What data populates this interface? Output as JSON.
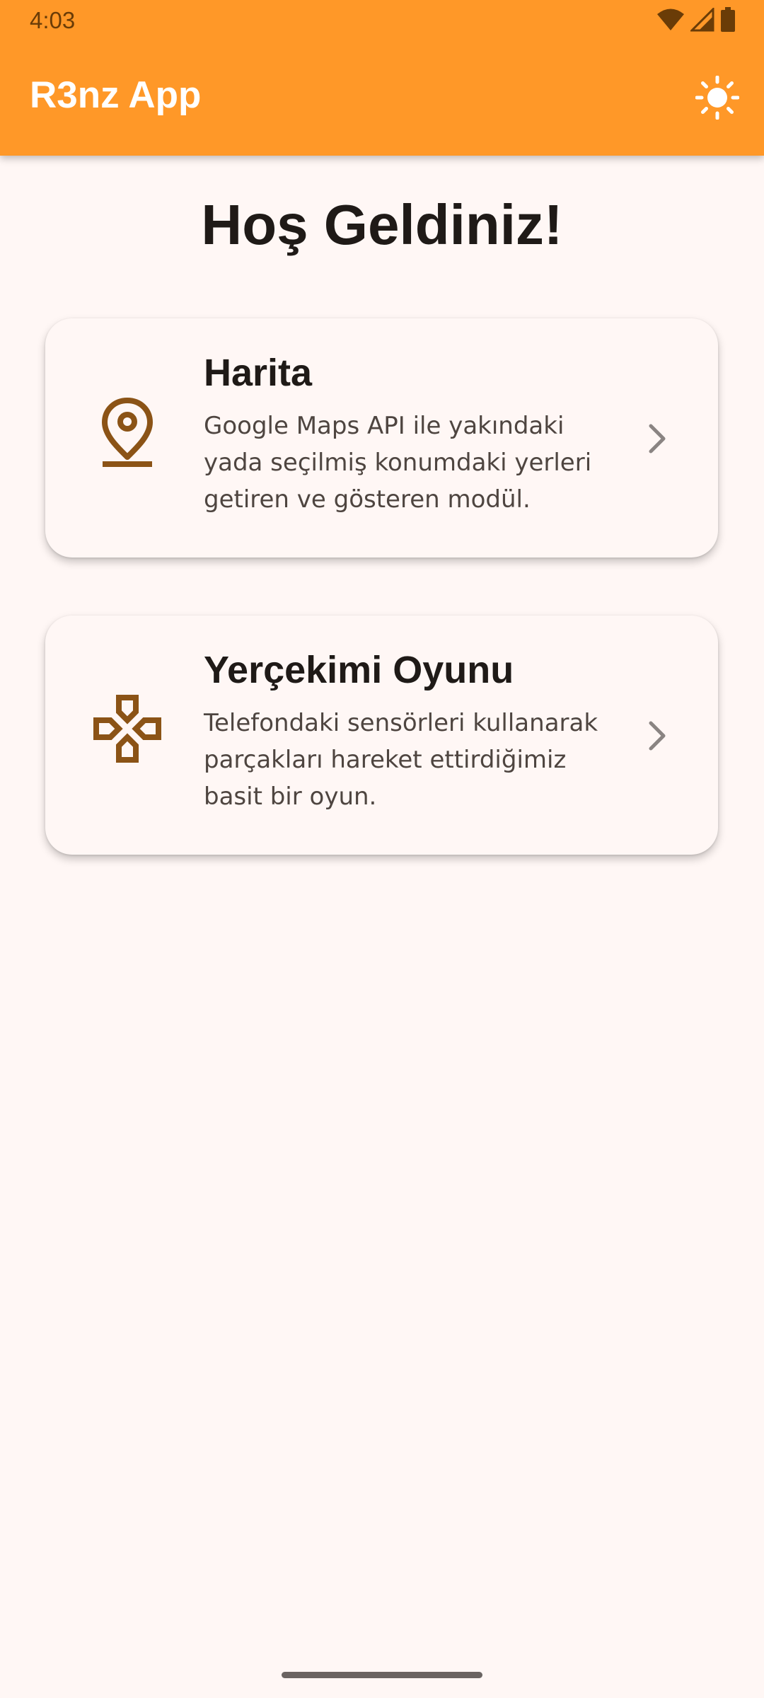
{
  "status_bar": {
    "time": "4:03",
    "icons": [
      "wifi-icon",
      "signal-icon",
      "battery-icon"
    ]
  },
  "app_bar": {
    "title": "R3nz App",
    "action_icon": "sun-icon",
    "background_color": "#FF9828"
  },
  "main": {
    "welcome_text": "Hoş Geldiniz!",
    "cards": [
      {
        "icon": "location-pin-icon",
        "title": "Harita",
        "description": "Google Maps API ile yakındaki yada seçilmiş konumdaki yerleri getiren ve gösteren modül."
      },
      {
        "icon": "gamepad-icon",
        "title": "Yerçekimi Oyunu",
        "description": "Telefondaki sensörleri kullanarak parçakları hareket ettirdiğimiz basit bir oyun."
      }
    ]
  },
  "colors": {
    "accent": "#FF9828",
    "icon_brown": "#8B5316",
    "background": "#FFF7F5"
  }
}
